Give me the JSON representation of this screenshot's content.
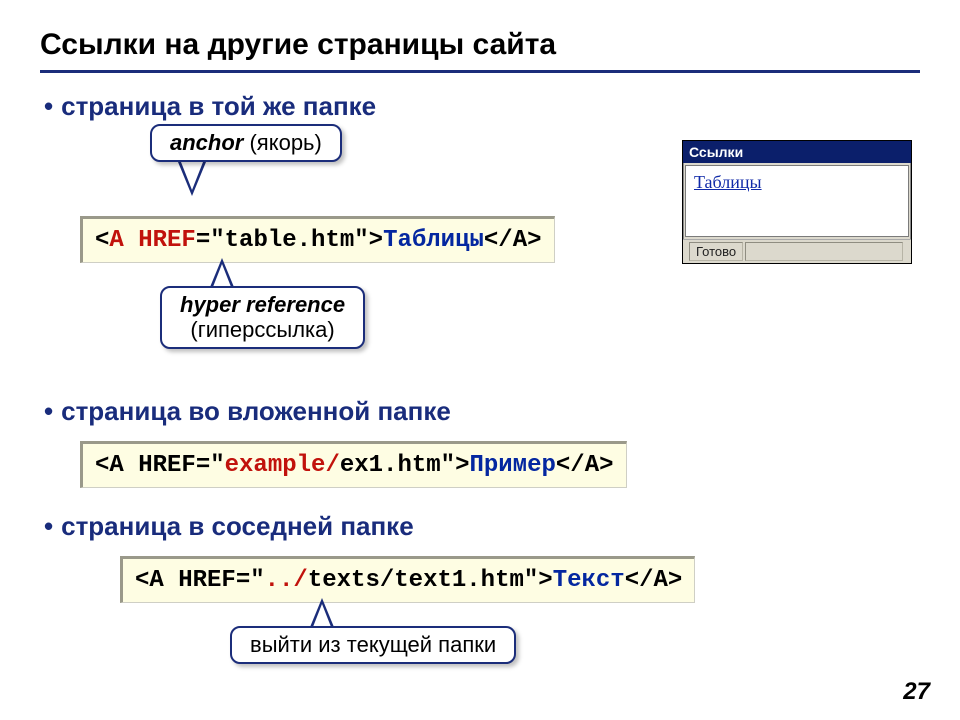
{
  "title": "Ссылки на другие страницы сайта",
  "bullets": {
    "b1": "страница в той же папке",
    "b2": "страница во вложенной папке",
    "b3": "страница в соседней папке"
  },
  "callouts": {
    "anchor_it": "anchor",
    "anchor_paren": " (якорь)",
    "href_it": "hyper reference",
    "href_paren": "(гиперссылка)",
    "updir": "выйти из текущей папки"
  },
  "code1": {
    "lt": "<",
    "a_open": "A",
    "sp": " ",
    "href_attr": "HREF",
    "eq": "=\"table.htm\">",
    "link": "Таблицы",
    "close": "</A>"
  },
  "code2": {
    "pre": "<A HREF=\"",
    "folder": "example/",
    "post1": "ex1.htm\">",
    "link": "Пример",
    "close": "</A>"
  },
  "code3": {
    "pre": "<A HREF=\"",
    "up": "../",
    "post1": "texts/text1.htm\">",
    "link": "Текст",
    "close": "</A>"
  },
  "browser": {
    "title": "Ссылки",
    "link": "Таблицы",
    "status": "Готово"
  },
  "page": "27"
}
